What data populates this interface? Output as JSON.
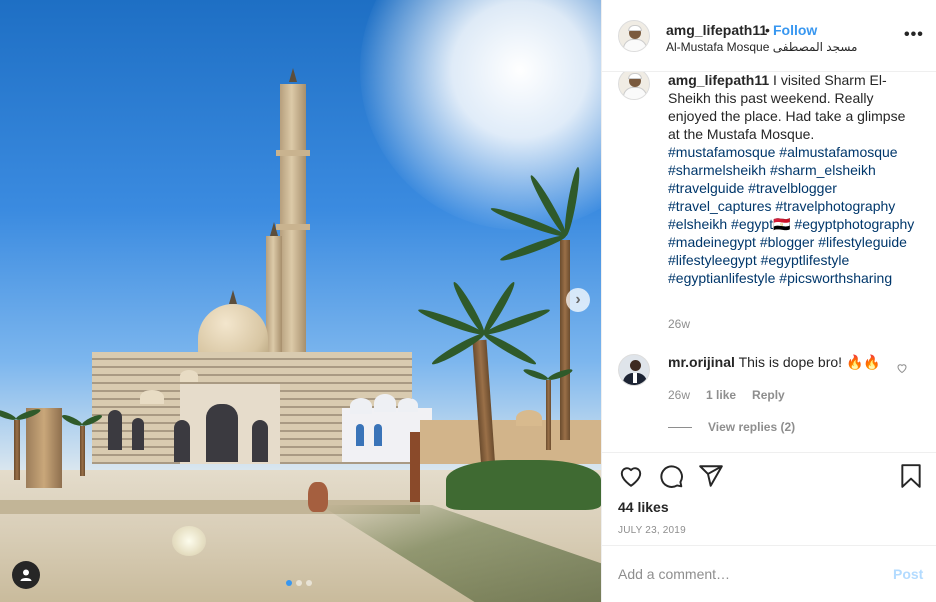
{
  "post": {
    "username": "amg_lifepath11",
    "separator": "•",
    "follow_label": "Follow",
    "location": "Al-Mustafa Mosque مسجد المصطفى",
    "more_label": "•••"
  },
  "caption": {
    "username": "amg_lifepath11",
    "text": "I visited Sharm El-Sheikh this past weekend. Really enjoyed the place. Had take a glimpse at the Mustafa Mosque.",
    "hashtags": [
      "#mustafamosque",
      "#almustafamosque",
      "#sharmelsheikh",
      "#sharm_elsheikh",
      "#travelguide",
      "#travelblogger",
      "#travel_captures",
      "#travelphotography",
      "#elsheikh",
      "#egypt🇪🇬",
      "#egyptphotography",
      "#madeinegypt",
      "#blogger",
      "#lifestyleguide",
      "#lifestyleegypt",
      "#egyptlifestyle",
      "#egyptianlifestyle",
      "#picsworthsharing"
    ],
    "time": "26w"
  },
  "comment": {
    "username": "mr.orijinal",
    "text": "This is dope bro! 🔥🔥",
    "time": "26w",
    "likes_label": "1 like",
    "reply_label": "Reply",
    "view_replies": "View replies (2)"
  },
  "engagement": {
    "likes": "44 likes",
    "date": "JULY 23, 2019"
  },
  "add_comment": {
    "placeholder": "Add a comment…",
    "post_label": "Post"
  },
  "carousel": {
    "total_slides": 3,
    "current_slide": 1
  },
  "colors": {
    "link_blue": "#3897f0",
    "hashtag_blue": "#00376b",
    "muted_gray": "#8e8e8e",
    "post_disabled": "#b3dbff"
  },
  "icons": [
    "next-arrow-icon",
    "user-tag-icon",
    "more-options-icon",
    "heart-icon",
    "comment-icon",
    "share-icon",
    "bookmark-icon"
  ]
}
